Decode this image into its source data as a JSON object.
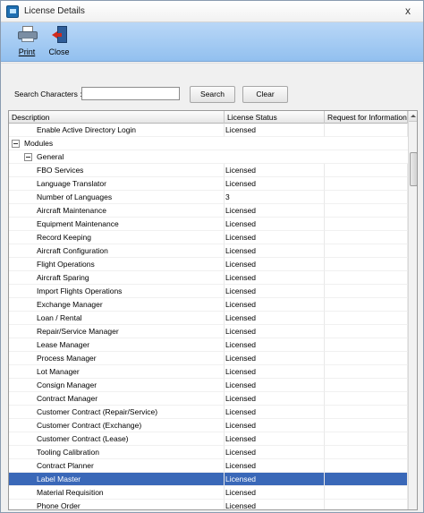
{
  "window": {
    "title": "License Details",
    "close_glyph": "x"
  },
  "toolbar": {
    "print_label": "Print",
    "close_label": "Close"
  },
  "search": {
    "label": "Search Characters :",
    "value": "",
    "search_button": "Search",
    "clear_button": "Clear"
  },
  "grid": {
    "columns": [
      "Description",
      "License Status",
      "Request for Information"
    ],
    "rows": [
      {
        "type": "item",
        "description": "Enable Active Directory Login",
        "status": "Licensed"
      },
      {
        "type": "group",
        "level": 0,
        "description": "Modules"
      },
      {
        "type": "group",
        "level": 1,
        "description": "General"
      },
      {
        "type": "item",
        "description": "FBO Services",
        "status": "Licensed"
      },
      {
        "type": "item",
        "description": "Language Translator",
        "status": "Licensed"
      },
      {
        "type": "item",
        "description": "Number of Languages",
        "status": "3"
      },
      {
        "type": "item",
        "description": "Aircraft Maintenance",
        "status": "Licensed"
      },
      {
        "type": "item",
        "description": "Equipment Maintenance",
        "status": "Licensed"
      },
      {
        "type": "item",
        "description": "Record Keeping",
        "status": "Licensed"
      },
      {
        "type": "item",
        "description": "Aircraft Configuration",
        "status": "Licensed"
      },
      {
        "type": "item",
        "description": "Flight Operations",
        "status": "Licensed"
      },
      {
        "type": "item",
        "description": "Aircraft Sparing",
        "status": "Licensed"
      },
      {
        "type": "item",
        "description": "Import Flights Operations",
        "status": "Licensed"
      },
      {
        "type": "item",
        "description": "Exchange Manager",
        "status": "Licensed"
      },
      {
        "type": "item",
        "description": "Loan / Rental",
        "status": "Licensed"
      },
      {
        "type": "item",
        "description": "Repair/Service Manager",
        "status": "Licensed"
      },
      {
        "type": "item",
        "description": "Lease Manager",
        "status": "Licensed"
      },
      {
        "type": "item",
        "description": "Process Manager",
        "status": "Licensed"
      },
      {
        "type": "item",
        "description": "Lot Manager",
        "status": "Licensed"
      },
      {
        "type": "item",
        "description": "Consign Manager",
        "status": "Licensed"
      },
      {
        "type": "item",
        "description": "Contract Manager",
        "status": "Licensed"
      },
      {
        "type": "item",
        "description": "Customer Contract (Repair/Service)",
        "status": "Licensed"
      },
      {
        "type": "item",
        "description": "Customer Contract (Exchange)",
        "status": "Licensed"
      },
      {
        "type": "item",
        "description": "Customer Contract (Lease)",
        "status": "Licensed"
      },
      {
        "type": "item",
        "description": "Tooling Calibration",
        "status": "Licensed"
      },
      {
        "type": "item",
        "description": "Contract Planner",
        "status": "Licensed"
      },
      {
        "type": "item",
        "description": "Label Master",
        "status": "Licensed",
        "selected": true
      },
      {
        "type": "item",
        "description": "Material Requisition",
        "status": "Licensed"
      },
      {
        "type": "item",
        "description": "Phone Order",
        "status": "Licensed"
      }
    ]
  },
  "colors": {
    "toolbar": "#a8cdf4",
    "selection": "#3a68b8"
  }
}
